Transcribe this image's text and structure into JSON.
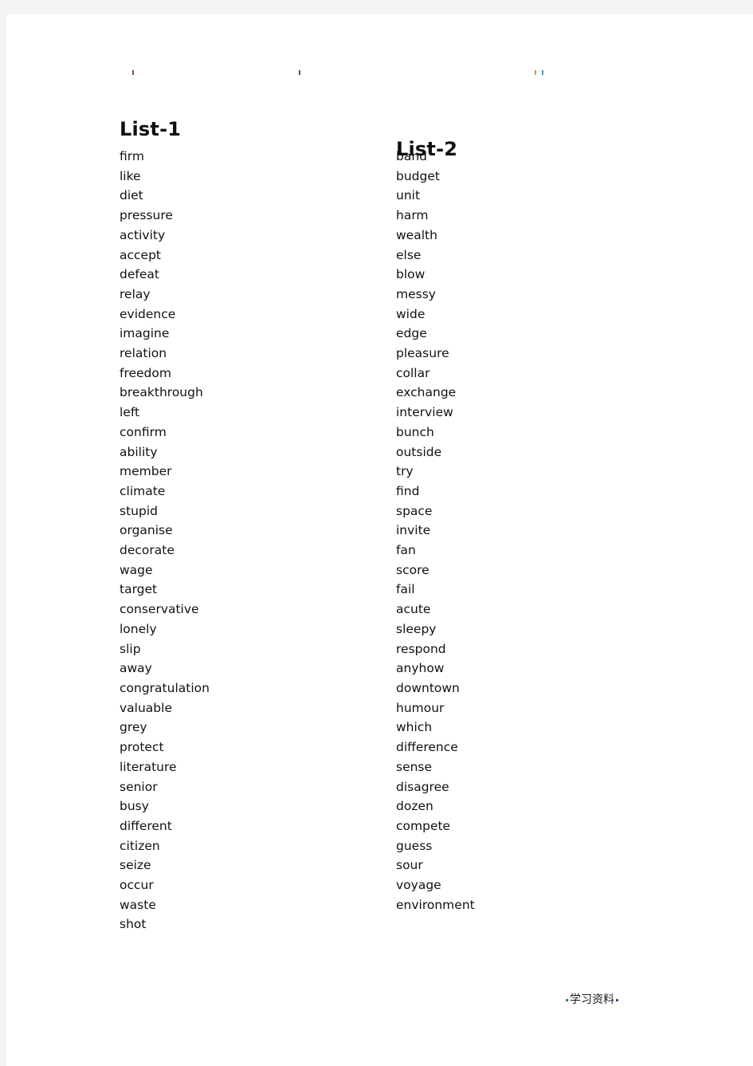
{
  "document": {
    "footer_text": "学习资料",
    "page_background": "#ffffff",
    "scan_margin_color": "#f4f4f4",
    "text_color": "#121212"
  },
  "columns": [
    {
      "heading": "List-1",
      "words": [
        "firm",
        "like",
        "diet",
        "pressure",
        "activity",
        "accept",
        "defeat",
        "relay",
        "evidence",
        "imagine",
        "relation",
        "freedom",
        "breakthrough",
        "left",
        "confirm",
        "ability",
        "member",
        "climate",
        "stupid",
        "organise",
        "decorate",
        "wage",
        "target",
        "conservative",
        "lonely",
        "slip",
        "away",
        "congratulation",
        "valuable",
        "grey",
        "protect",
        "literature",
        "senior",
        "busy",
        "different",
        "citizen",
        "seize",
        "occur",
        "waste",
        "shot"
      ]
    },
    {
      "heading": "List-2",
      "words": [
        "band",
        "budget",
        "unit",
        "harm",
        "wealth",
        "else",
        "blow",
        "messy",
        "wide",
        "edge",
        "pleasure",
        "collar",
        "exchange",
        "interview",
        "bunch",
        "outside",
        "try",
        "find",
        "space",
        "invite",
        "fan",
        "score",
        "fail",
        "acute",
        "sleepy",
        "respond",
        "anyhow",
        "downtown",
        "humour",
        "which",
        "difference",
        "sense",
        "disagree",
        "dozen",
        "compete",
        "guess",
        "sour",
        "voyage",
        "environment"
      ]
    }
  ]
}
